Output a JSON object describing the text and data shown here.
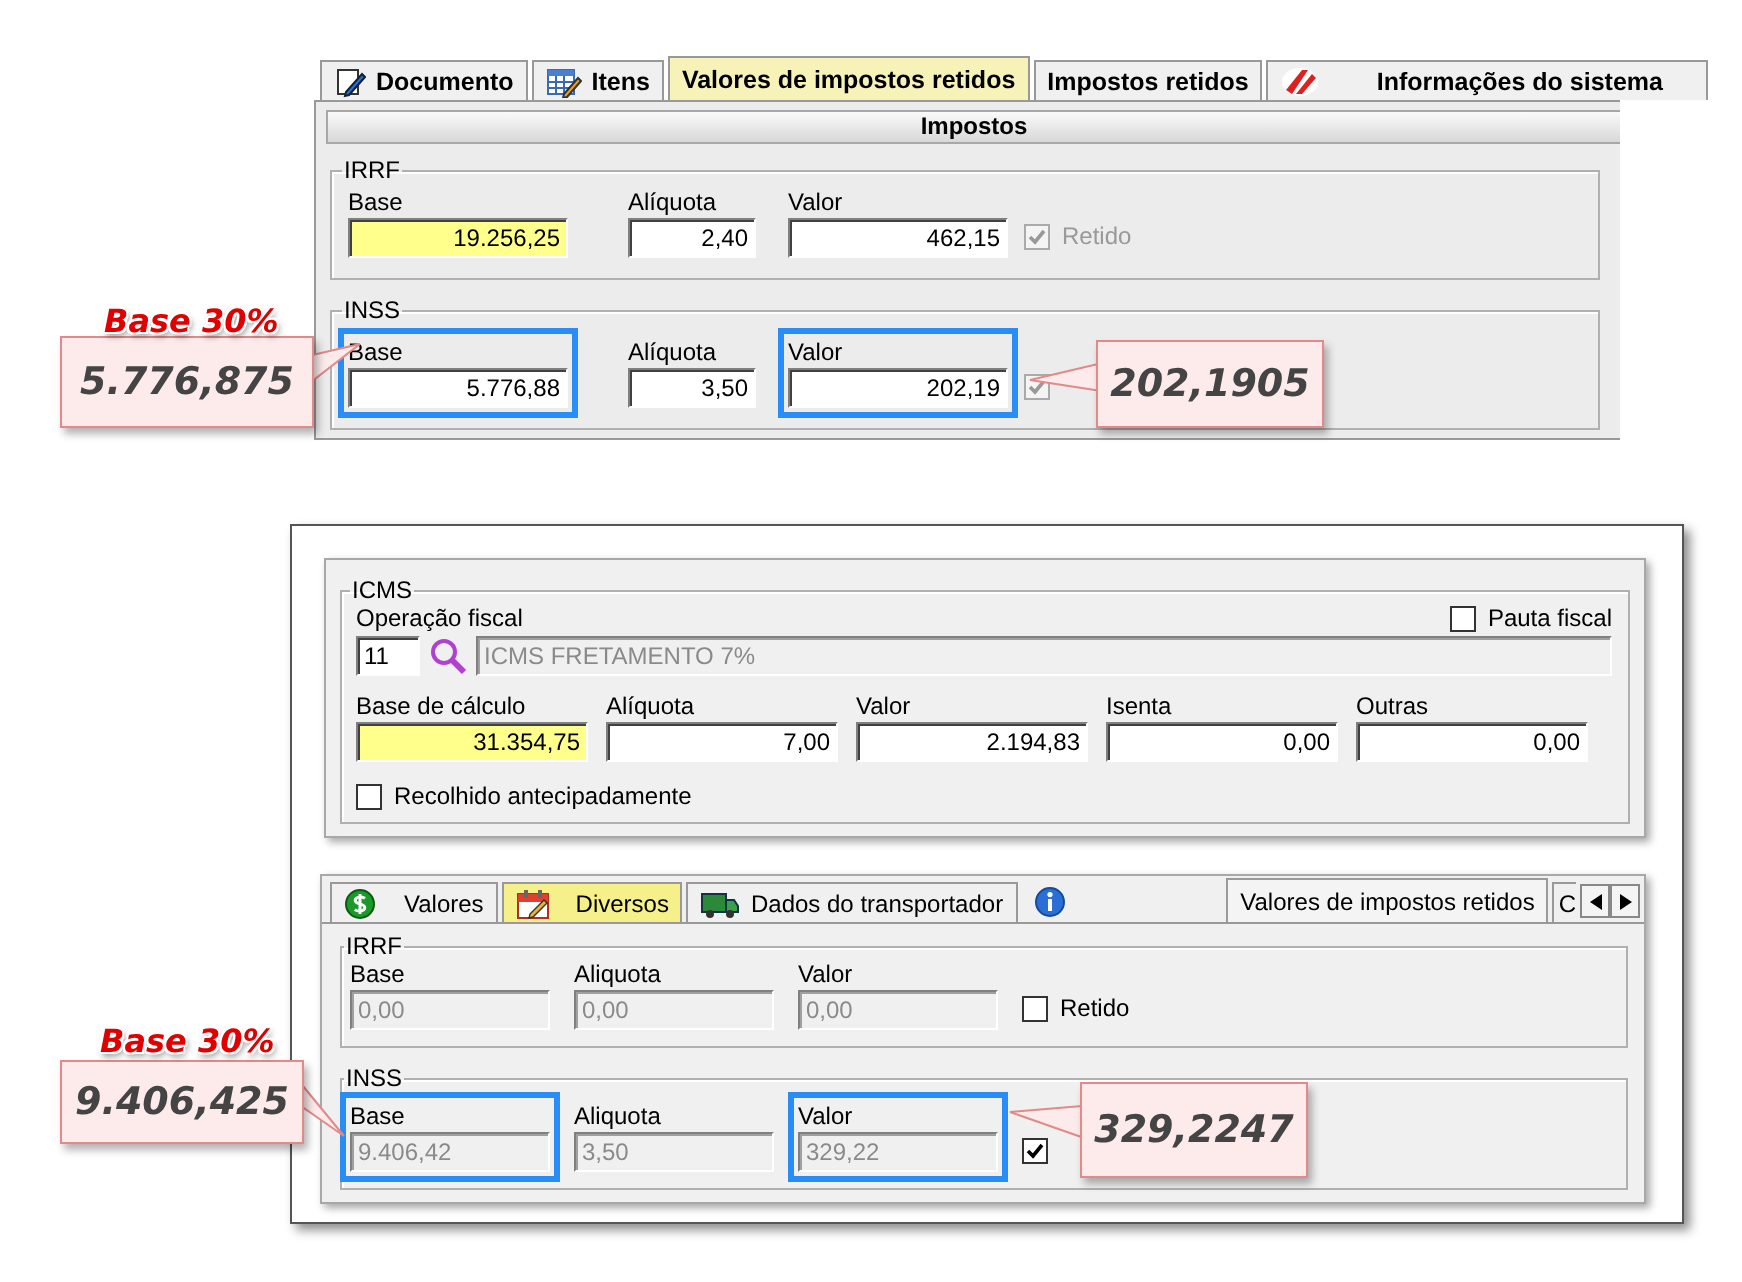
{
  "top_form": {
    "tabs": [
      {
        "label": "Documento",
        "selected": false
      },
      {
        "label": "Itens",
        "selected": false
      },
      {
        "label": "Valores de impostos retidos",
        "selected": true
      },
      {
        "label": "Impostos retidos",
        "selected": false
      },
      {
        "label": "Informações do sistema",
        "selected": false
      }
    ],
    "section_title": "Impostos",
    "groups": [
      {
        "title": "IRRF",
        "fields": [
          {
            "label": "Base",
            "value": "19.256,25",
            "highlighted": true,
            "annotated": false,
            "disabled": false
          },
          {
            "label": "Alíquota",
            "value": "2,40",
            "highlighted": false,
            "annotated": false,
            "disabled": false
          },
          {
            "label": "Valor",
            "value": "462,15",
            "highlighted": false,
            "annotated": false,
            "disabled": false
          }
        ],
        "retained": {
          "label": "Retido",
          "checked": true,
          "disabled": true
        }
      },
      {
        "title": "INSS",
        "fields": [
          {
            "label": "Base",
            "value": "5.776,88",
            "highlighted": false,
            "annotated": true,
            "disabled": false
          },
          {
            "label": "Alíquota",
            "value": "3,50",
            "highlighted": false,
            "annotated": false,
            "disabled": false
          },
          {
            "label": "Valor",
            "value": "202,19",
            "highlighted": false,
            "annotated": true,
            "disabled": false
          }
        ],
        "retained": {
          "checked": true,
          "disabled": true
        }
      }
    ]
  },
  "bottom_form": {
    "icms": {
      "title": "ICMS",
      "operation_label": "Operação fiscal",
      "operation_code": {
        "value": "11",
        "disabled": false
      },
      "operation_description": {
        "value": "ICMS FRETAMENTO 7%",
        "disabled": true
      },
      "pauta_fiscal": {
        "label": "Pauta fiscal",
        "checked": false
      },
      "fields": [
        {
          "label": "Base de cálculo",
          "value": "31.354,75",
          "highlighted": true,
          "disabled": false
        },
        {
          "label": "Alíquota",
          "value": "7,00",
          "highlighted": false,
          "disabled": false
        },
        {
          "label": "Valor",
          "value": "2.194,83",
          "highlighted": false,
          "disabled": false
        },
        {
          "label": "Isenta",
          "value": "0,00",
          "highlighted": false,
          "disabled": false
        },
        {
          "label": "Outras",
          "value": "0,00",
          "highlighted": false,
          "disabled": false
        }
      ],
      "recolhido": {
        "label": "Recolhido antecipadamente",
        "checked": false
      }
    },
    "tabs": [
      {
        "kind": "text",
        "label": "Valores",
        "selected": false,
        "highlighted": false
      },
      {
        "kind": "text",
        "label": "Diversos",
        "selected": false,
        "highlighted": true
      },
      {
        "kind": "text",
        "label": "Dados do transportador",
        "selected": false,
        "highlighted": false
      },
      {
        "kind": "icon",
        "selected": false
      },
      {
        "kind": "text",
        "label": "Valores de impostos retidos",
        "selected": true,
        "highlighted": false
      },
      {
        "kind": "text",
        "label": "C",
        "selected": false,
        "highlighted": false
      }
    ],
    "groups": [
      {
        "title": "IRRF",
        "fields": [
          {
            "label": "Base",
            "value": "0,00",
            "annotated": false,
            "disabled": true
          },
          {
            "label": "Aliquota",
            "value": "0,00",
            "annotated": false,
            "disabled": true
          },
          {
            "label": "Valor",
            "value": "0,00",
            "annotated": false,
            "disabled": true
          }
        ],
        "retained": {
          "label": "Retido",
          "checked": false,
          "disabled": false
        }
      },
      {
        "title": "INSS",
        "fields": [
          {
            "label": "Base",
            "value": "9.406,42",
            "annotated": true,
            "disabled": true
          },
          {
            "label": "Aliquota",
            "value": "3,50",
            "annotated": false,
            "disabled": true
          },
          {
            "label": "Valor",
            "value": "329,22",
            "annotated": true,
            "disabled": true
          }
        ],
        "retained": {
          "checked": true,
          "disabled": false
        }
      }
    ]
  },
  "callouts": [
    {
      "title": "Base 30%",
      "value": "5.776,875"
    },
    {
      "value": "202,1905"
    },
    {
      "title": "Base 30%",
      "value": "9.406,425"
    },
    {
      "value": "329,2247"
    }
  ]
}
